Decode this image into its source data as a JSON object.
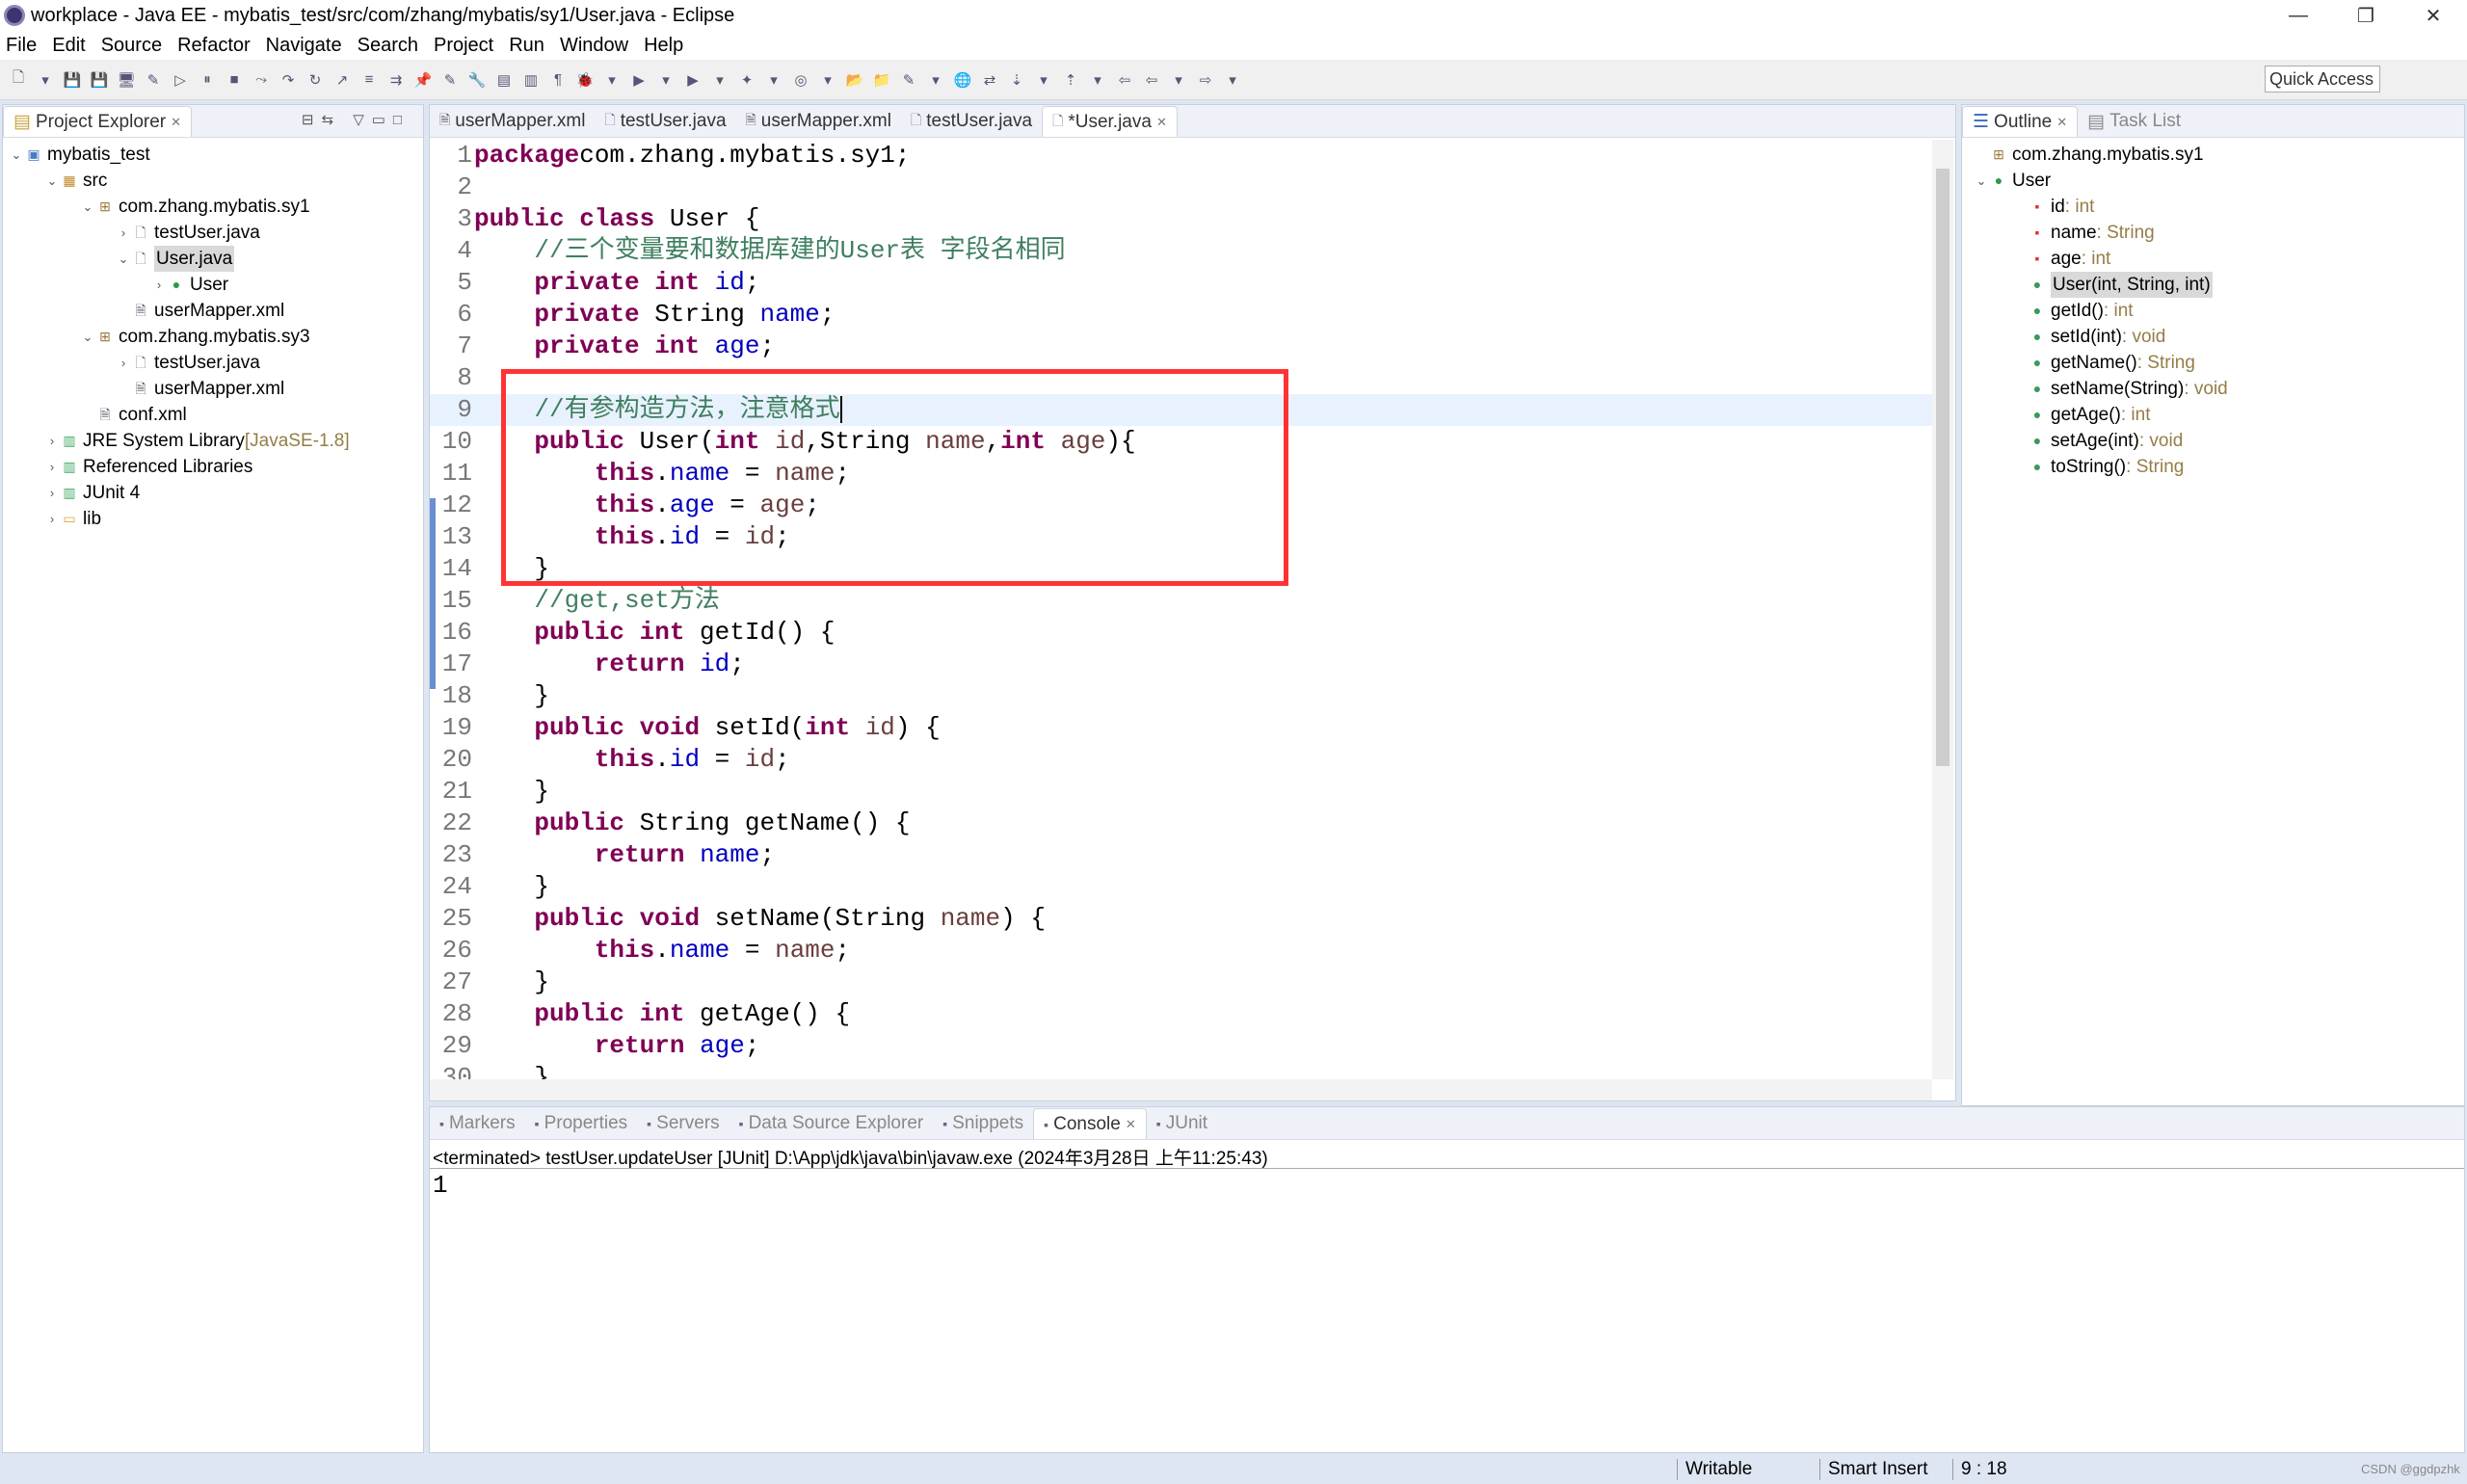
{
  "window": {
    "title": "workplace - Java EE - mybatis_test/src/com/zhang/mybatis/sy1/User.java - Eclipse",
    "minimize": "—",
    "restore": "❐",
    "close": "✕"
  },
  "menu": [
    "File",
    "Edit",
    "Source",
    "Refactor",
    "Navigate",
    "Search",
    "Project",
    "Run",
    "Window",
    "Help"
  ],
  "toolbar": {
    "quick_access": "Quick Access"
  },
  "project_explorer": {
    "title": "Project Explorer",
    "items": [
      {
        "label": "mybatis_test",
        "depth": 0,
        "arrow": "v",
        "icon": "project-icon"
      },
      {
        "label": "src",
        "depth": 1,
        "arrow": "v",
        "icon": "source-folder-icon"
      },
      {
        "label": "com.zhang.mybatis.sy1",
        "depth": 2,
        "arrow": "v",
        "icon": "package-icon"
      },
      {
        "label": "testUser.java",
        "depth": 3,
        "arrow": ">",
        "icon": "java-file-icon"
      },
      {
        "label": "User.java",
        "depth": 3,
        "arrow": "v",
        "icon": "java-file-icon",
        "selected": true
      },
      {
        "label": "User",
        "depth": 4,
        "arrow": ">",
        "icon": "class-icon"
      },
      {
        "label": "userMapper.xml",
        "depth": 3,
        "arrow": "",
        "icon": "xml-file-icon"
      },
      {
        "label": "com.zhang.mybatis.sy3",
        "depth": 2,
        "arrow": "v",
        "icon": "package-icon"
      },
      {
        "label": "testUser.java",
        "depth": 3,
        "arrow": ">",
        "icon": "java-file-icon"
      },
      {
        "label": "userMapper.xml",
        "depth": 3,
        "arrow": "",
        "icon": "xml-file-icon"
      },
      {
        "label": "conf.xml",
        "depth": 2,
        "arrow": "",
        "icon": "xml-file-icon"
      },
      {
        "label": "JRE System Library",
        "suffix": " [JavaSE-1.8]",
        "depth": 1,
        "arrow": ">",
        "icon": "library-icon"
      },
      {
        "label": "Referenced Libraries",
        "depth": 1,
        "arrow": ">",
        "icon": "library-icon"
      },
      {
        "label": "JUnit 4",
        "depth": 1,
        "arrow": ">",
        "icon": "library-icon"
      },
      {
        "label": "lib",
        "depth": 1,
        "arrow": ">",
        "icon": "folder-icon"
      }
    ]
  },
  "editor": {
    "tabs": [
      {
        "label": "userMapper.xml",
        "icon": "xml-file-icon"
      },
      {
        "label": "testUser.java",
        "icon": "java-file-icon"
      },
      {
        "label": "userMapper.xml",
        "icon": "xml-file-icon"
      },
      {
        "label": "testUser.java",
        "icon": "java-file-icon"
      },
      {
        "label": "*User.java",
        "icon": "java-file-icon",
        "active": true
      }
    ],
    "current_line": 9,
    "lines": [
      [
        [
          "kw",
          "package"
        ],
        [
          "",
          "com.zhang.mybatis.sy1;"
        ]
      ],
      [],
      [
        [
          "kw",
          "public class"
        ],
        [
          "",
          " User {"
        ]
      ],
      [
        [
          "",
          "    "
        ],
        [
          "cm",
          "//三个变量要和数据库建的User表 字段名相同"
        ]
      ],
      [
        [
          "",
          "    "
        ],
        [
          "kw",
          "private int"
        ],
        [
          "",
          " "
        ],
        [
          "fd",
          "id"
        ],
        [
          "",
          ";"
        ]
      ],
      [
        [
          "",
          "    "
        ],
        [
          "kw",
          "private"
        ],
        [
          "",
          " String "
        ],
        [
          "fd",
          "name"
        ],
        [
          "",
          ";"
        ]
      ],
      [
        [
          "",
          "    "
        ],
        [
          "kw",
          "private int"
        ],
        [
          "",
          " "
        ],
        [
          "fd",
          "age"
        ],
        [
          "",
          ";"
        ]
      ],
      [],
      [
        [
          "",
          "    "
        ],
        [
          "cm",
          "//有参构造方法，注意格式"
        ]
      ],
      [
        [
          "",
          "    "
        ],
        [
          "kw",
          "public"
        ],
        [
          "",
          " User("
        ],
        [
          "kw",
          "int"
        ],
        [
          "",
          " "
        ],
        [
          "pm",
          "id"
        ],
        [
          "",
          ",String "
        ],
        [
          "pm",
          "name"
        ],
        [
          "",
          ","
        ],
        [
          "kw",
          "int"
        ],
        [
          "",
          " "
        ],
        [
          "pm",
          "age"
        ],
        [
          "",
          "){"
        ]
      ],
      [
        [
          "",
          "        "
        ],
        [
          "kw",
          "this"
        ],
        [
          "",
          "."
        ],
        [
          "fd",
          "name"
        ],
        [
          "",
          " = "
        ],
        [
          "pm",
          "name"
        ],
        [
          "",
          ";"
        ]
      ],
      [
        [
          "",
          "        "
        ],
        [
          "kw",
          "this"
        ],
        [
          "",
          "."
        ],
        [
          "fd",
          "age"
        ],
        [
          "",
          " = "
        ],
        [
          "pm",
          "age"
        ],
        [
          "",
          ";"
        ]
      ],
      [
        [
          "",
          "        "
        ],
        [
          "kw",
          "this"
        ],
        [
          "",
          "."
        ],
        [
          "fd",
          "id"
        ],
        [
          "",
          " = "
        ],
        [
          "pm",
          "id"
        ],
        [
          "",
          ";"
        ]
      ],
      [
        [
          "",
          "    }"
        ]
      ],
      [
        [
          "",
          "    "
        ],
        [
          "cm",
          "//get,set方法"
        ]
      ],
      [
        [
          "",
          "    "
        ],
        [
          "kw",
          "public int"
        ],
        [
          "",
          " getId() {"
        ]
      ],
      [
        [
          "",
          "        "
        ],
        [
          "kw",
          "return"
        ],
        [
          "",
          " "
        ],
        [
          "fd",
          "id"
        ],
        [
          "",
          ";"
        ]
      ],
      [
        [
          "",
          "    }"
        ]
      ],
      [
        [
          "",
          "    "
        ],
        [
          "kw",
          "public void"
        ],
        [
          "",
          " setId("
        ],
        [
          "kw",
          "int"
        ],
        [
          "",
          " "
        ],
        [
          "pm",
          "id"
        ],
        [
          "",
          ") {"
        ]
      ],
      [
        [
          "",
          "        "
        ],
        [
          "kw",
          "this"
        ],
        [
          "",
          "."
        ],
        [
          "fd",
          "id"
        ],
        [
          "",
          " = "
        ],
        [
          "pm",
          "id"
        ],
        [
          "",
          ";"
        ]
      ],
      [
        [
          "",
          "    }"
        ]
      ],
      [
        [
          "",
          "    "
        ],
        [
          "kw",
          "public"
        ],
        [
          "",
          " String getName() {"
        ]
      ],
      [
        [
          "",
          "        "
        ],
        [
          "kw",
          "return"
        ],
        [
          "",
          " "
        ],
        [
          "fd",
          "name"
        ],
        [
          "",
          ";"
        ]
      ],
      [
        [
          "",
          "    }"
        ]
      ],
      [
        [
          "",
          "    "
        ],
        [
          "kw",
          "public void"
        ],
        [
          "",
          " setName(String "
        ],
        [
          "pm",
          "name"
        ],
        [
          "",
          ") {"
        ]
      ],
      [
        [
          "",
          "        "
        ],
        [
          "kw",
          "this"
        ],
        [
          "",
          "."
        ],
        [
          "fd",
          "name"
        ],
        [
          "",
          " = "
        ],
        [
          "pm",
          "name"
        ],
        [
          "",
          ";"
        ]
      ],
      [
        [
          "",
          "    }"
        ]
      ],
      [
        [
          "",
          "    "
        ],
        [
          "kw",
          "public int"
        ],
        [
          "",
          " getAge() {"
        ]
      ],
      [
        [
          "",
          "        "
        ],
        [
          "kw",
          "return"
        ],
        [
          "",
          " "
        ],
        [
          "fd",
          "age"
        ],
        [
          "",
          ";"
        ]
      ],
      [
        [
          "",
          "    }"
        ]
      ]
    ],
    "highlight_color": "#ff3333"
  },
  "outline": {
    "title": "Outline",
    "other_tab": "Task List",
    "items": [
      {
        "label": "com.zhang.mybatis.sy1",
        "type": "",
        "depth": 0,
        "icon": "package-icon"
      },
      {
        "label": "User",
        "type": "",
        "depth": 0,
        "icon": "class-icon",
        "arrow": "v"
      },
      {
        "label": "id",
        "type": " : int",
        "depth": 1,
        "icon": "private-field-icon"
      },
      {
        "label": "name",
        "type": " : String",
        "depth": 1,
        "icon": "private-field-icon"
      },
      {
        "label": "age",
        "type": " : int",
        "depth": 1,
        "icon": "private-field-icon"
      },
      {
        "label": "User(int, String, int)",
        "type": "",
        "depth": 1,
        "icon": "constructor-icon",
        "selected": true
      },
      {
        "label": "getId()",
        "type": " : int",
        "depth": 1,
        "icon": "public-method-icon"
      },
      {
        "label": "setId(int)",
        "type": " : void",
        "depth": 1,
        "icon": "public-method-icon"
      },
      {
        "label": "getName()",
        "type": " : String",
        "depth": 1,
        "icon": "public-method-icon"
      },
      {
        "label": "setName(String)",
        "type": " : void",
        "depth": 1,
        "icon": "public-method-icon"
      },
      {
        "label": "getAge()",
        "type": " : int",
        "depth": 1,
        "icon": "public-method-icon"
      },
      {
        "label": "setAge(int)",
        "type": " : void",
        "depth": 1,
        "icon": "public-method-icon"
      },
      {
        "label": "toString()",
        "type": " : String",
        "depth": 1,
        "icon": "override-method-icon"
      }
    ]
  },
  "bottom": {
    "tabs": [
      {
        "label": "Markers"
      },
      {
        "label": "Properties"
      },
      {
        "label": "Servers"
      },
      {
        "label": "Data Source Explorer"
      },
      {
        "label": "Snippets"
      },
      {
        "label": "Console",
        "active": true
      },
      {
        "label": "JUnit"
      }
    ],
    "console_header": "<terminated> testUser.updateUser [JUnit] D:\\App\\jdk\\java\\bin\\javaw.exe (2024年3月28日 上午11:25:43)",
    "console_output": "1"
  },
  "status": {
    "writable": "Writable",
    "insert_mode": "Smart Insert",
    "position": "9 : 18",
    "watermark": "CSDN @ggdpzhk"
  }
}
